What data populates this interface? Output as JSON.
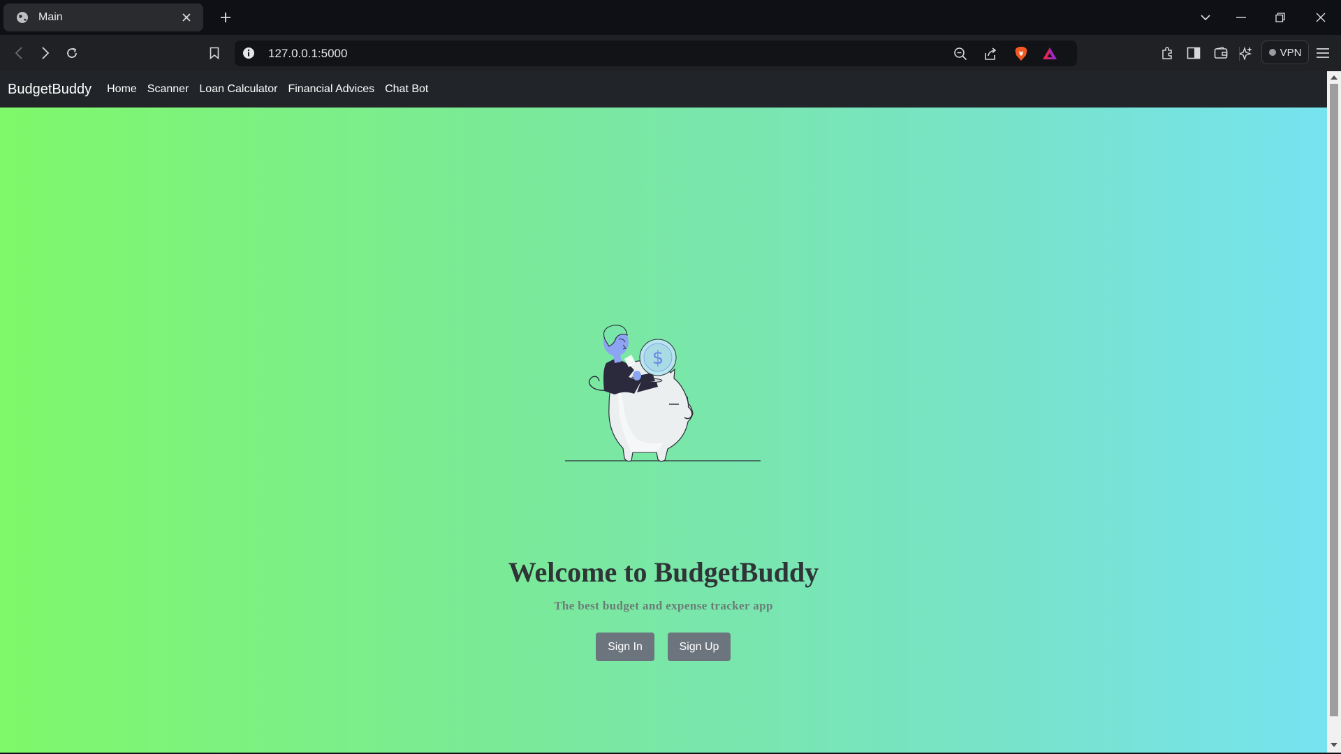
{
  "browser": {
    "tab": {
      "title": "Main",
      "icon": "globe-icon"
    },
    "address": {
      "url": "127.0.0.1:5000"
    },
    "vpn_label": "VPN",
    "colors": {
      "chrome_bg": "#0f1015",
      "toolbar_bg": "#202124",
      "tab_bg": "#2a2b2f"
    }
  },
  "navbar": {
    "brand": "BudgetBuddy",
    "links": [
      "Home",
      "Scanner",
      "Loan Calculator",
      "Financial Advices",
      "Chat Bot"
    ],
    "bg_color": "#212529"
  },
  "hero": {
    "title": "Welcome to BudgetBuddy",
    "subtitle": "The best budget and expense tracker app",
    "sign_in_label": "Sign In",
    "sign_up_label": "Sign Up",
    "illustration": "person-with-coin-on-piggy-bank",
    "coin_symbol": "$",
    "gradient": [
      "#7ff86a",
      "#76e3f0"
    ],
    "button_color": "#6c757d"
  }
}
